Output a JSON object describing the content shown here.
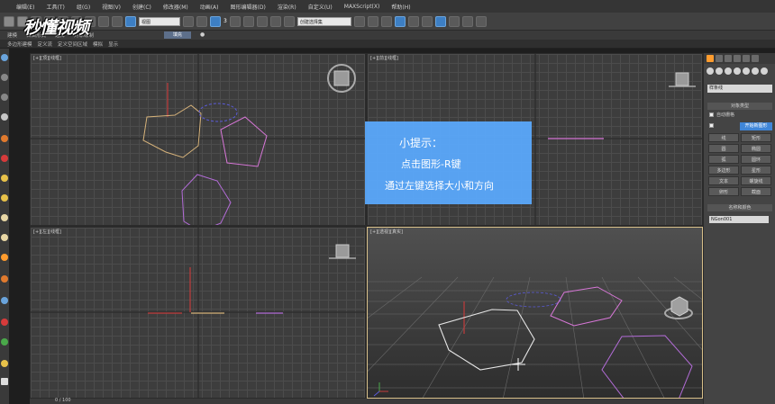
{
  "menu": [
    "编辑(E)",
    "工具(T)",
    "组(G)",
    "视图(V)",
    "创建(C)",
    "修改器(M)",
    "动画(A)",
    "图形编辑器(D)",
    "渲染(R)",
    "自定义(U)",
    "MAXScript(X)",
    "帮助(H)"
  ],
  "toolbar": {
    "view_dropdown": "视图",
    "number_label": "3",
    "selection_set_placeholder": "创建选择集"
  },
  "logo": "秒懂视频",
  "ribbon": {
    "labels": [
      "建模",
      "自由形式",
      "选择",
      "对象绘制"
    ],
    "fill_button": "填充",
    "dot": "●"
  },
  "subribbon": {
    "labels": [
      "多边形建模",
      "定义流",
      "定义空间区域",
      "模拟",
      "显示"
    ]
  },
  "viewports": {
    "top": "[+][顶][线框]",
    "front": "[+][前][线框]",
    "left": "[+][左][线框]",
    "persp": "[+][透视][真实]"
  },
  "tip": {
    "line1": "小提示：",
    "line2": "点击图形-R键",
    "line3": "通过左键选择大小和方向"
  },
  "command_panel": {
    "dropdown": "样条线",
    "rollout_object_type": "对象类型",
    "auto_grid": "自动栅格",
    "start_new_shape": "开始新图形",
    "buttons": [
      "线",
      "矩形",
      "圆",
      "椭圆",
      "弧",
      "圆环",
      "多边形",
      "星形",
      "文本",
      "螺旋线",
      "卵形",
      "截面"
    ],
    "rollout_name_color": "名称和颜色",
    "name_value": "NGon001"
  },
  "timeline": {
    "frame": "0 / 100"
  },
  "colors": {
    "tip_bg": "#5aaaff",
    "highlight": "#3f86d8",
    "active_tab": "#ff9c2e"
  }
}
